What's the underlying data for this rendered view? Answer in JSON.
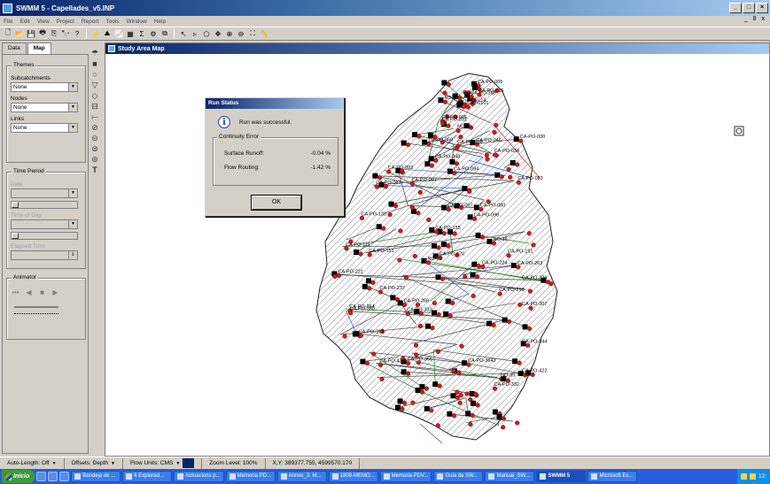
{
  "window": {
    "title": "SWMM 5 - Capellades_v5.INP",
    "mdi_buttons": "_ 8 x"
  },
  "menu": [
    "File",
    "Edit",
    "View",
    "Project",
    "Report",
    "Tools",
    "Window",
    "Help"
  ],
  "toolbar_icons": [
    "new-icon",
    "open-icon",
    "save-icon",
    "print-icon",
    "copy-icon",
    "find-icon",
    "query-icon",
    "run-icon",
    "profile-icon",
    "graph-icon",
    "table-icon",
    "statistics-icon",
    "options-icon",
    "arrange-icon",
    "select-icon",
    "vertex-icon",
    "region-icon",
    "pan-icon",
    "zoom-in-icon",
    "zoom-out-icon",
    "full-extent-icon",
    "measure-icon"
  ],
  "browser": {
    "tabs": [
      "Data",
      "Map"
    ],
    "active_tab": "Map",
    "themes": {
      "title": "Themes",
      "subcatchments_label": "Subcatchments",
      "subcatchments_value": "None",
      "nodes_label": "Nodes",
      "nodes_value": "None",
      "links_label": "Links",
      "links_value": "None"
    },
    "time_period": {
      "title": "Time Period",
      "date_label": "Date",
      "time_label": "Time of Day",
      "elapsed_label": "Elapsed Time"
    },
    "animator": {
      "title": "Animator"
    }
  },
  "map_window": {
    "title": "Study Area Map"
  },
  "run_status": {
    "title": "Run Status",
    "message": "Run was successful.",
    "continuity_title": "Continuity Error",
    "rows": [
      {
        "label": "Surface Runoff:",
        "value": "-0.04 %"
      },
      {
        "label": "Flow Routing:",
        "value": "-1.42 %"
      }
    ],
    "ok_label": "OK"
  },
  "map_labels": [
    "C40-0101",
    "CA-PO-005",
    "CA-PO-005",
    "NO-14",
    "NO-12",
    "CA-PO-015",
    "CA-PO-388",
    "CA-PO-031",
    "CA-PO-046",
    "NO-06",
    "CA-PO-030",
    "CA-PO-038",
    "CA-PO-048",
    "CA-PO-034",
    "TC-PO-060",
    "CA-PO-061",
    "CA-PO-067",
    "CA-PO-083",
    "CA-PO-080",
    "CA-PO-093",
    "CA-PO-094",
    "CA-PO-097",
    "CA-PO-098",
    "CA-PO-111",
    "NO-16",
    "CA-PO-138",
    "CA-PO-155",
    "CA-PO-151",
    "CA-PO-170",
    "CA-PO-191",
    "NO-51",
    "CA-PO-218",
    "CA-PO-221",
    "CA-PO-224",
    "CA-PO-226",
    "CA-PO-237",
    "CA-PO-263",
    "CA-PO-264",
    "CA-PO-268",
    "CA-PO-307",
    "CA-PO-313",
    "CA-PO-333",
    "CA-PO-344",
    "CA-PO-350",
    "CA-PO-356",
    "NO-39",
    "CA-PO-422",
    "CA-PO-423",
    "CA-PO-3643",
    "CA-PO-332"
  ],
  "status_bar": {
    "auto_length": "Auto-Length: Off",
    "offsets": "Offsets: Depth",
    "flow_units": "Flow Units: CMS",
    "zoom": "Zoom Level: 100%",
    "xy": "X,Y: 389377.755, 4599570.170"
  },
  "taskbar": {
    "start": "Inicio",
    "tasks": [
      {
        "label": "Bandeja de ...",
        "active": false
      },
      {
        "label": "6 Explorad...",
        "active": false
      },
      {
        "label": "Actuacions p...",
        "active": false
      },
      {
        "label": "Memoria PD...",
        "active": false
      },
      {
        "label": "Annex_3. M...",
        "active": false
      },
      {
        "label": "1809-MEMO...",
        "active": false
      },
      {
        "label": "Memoria PDV...",
        "active": false
      },
      {
        "label": "Guia de SW...",
        "active": false
      },
      {
        "label": "Manual_SW...",
        "active": false
      },
      {
        "label": "SWMM 5",
        "active": true
      },
      {
        "label": "Microsoft Ex...",
        "active": false
      }
    ],
    "clock": "12:"
  }
}
